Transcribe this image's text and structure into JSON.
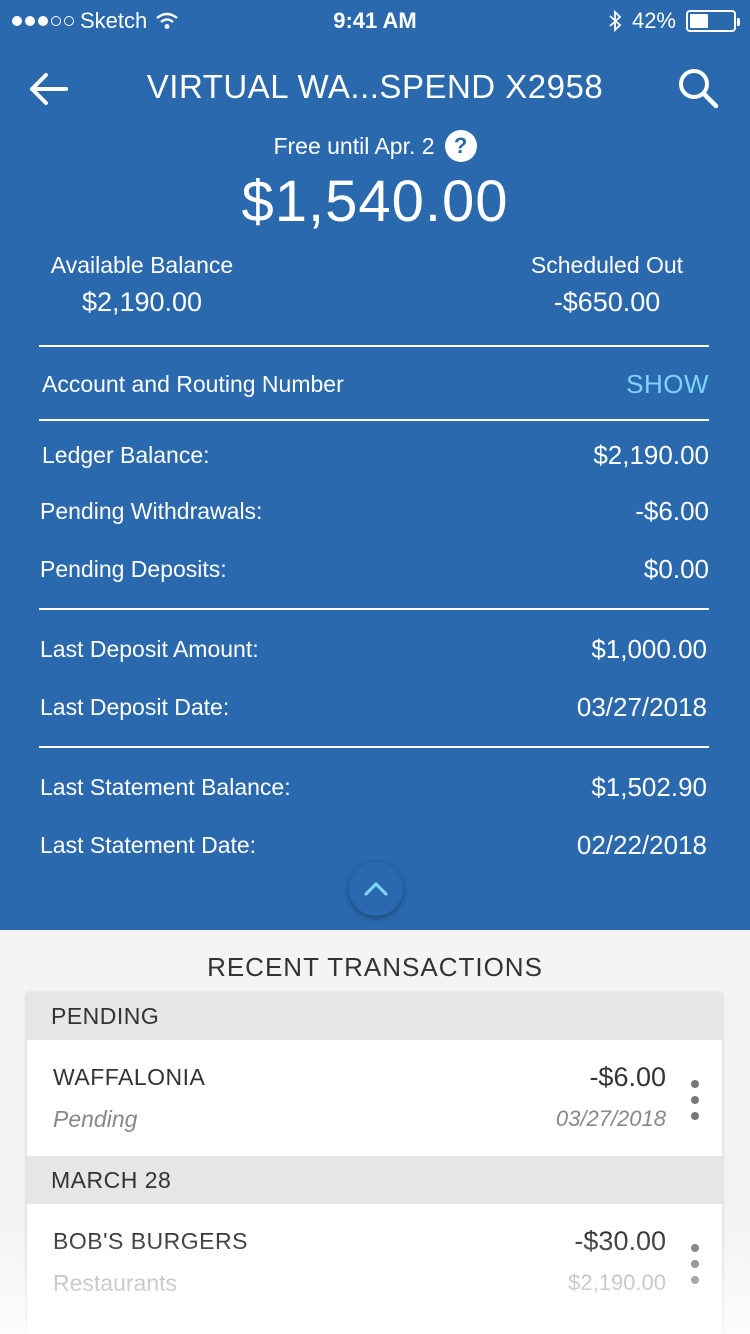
{
  "status_bar": {
    "carrier": "Sketch",
    "time": "9:41 AM",
    "battery": "42%",
    "battery_level": 0.42
  },
  "nav": {
    "title": "VIRTUAL WA...SPEND X2958"
  },
  "summary": {
    "free_until": "Free until Apr. 2",
    "main_balance": "$1,540.00",
    "available_label": "Available Balance",
    "available_value": "$2,190.00",
    "scheduled_label": "Scheduled Out",
    "scheduled_value": "-$650.00"
  },
  "account_routing": {
    "label": "Account and Routing Number",
    "action": "SHOW"
  },
  "details": {
    "ledger_label": "Ledger Balance:",
    "ledger_value": "$2,190.00",
    "pending_withdrawals_label": "Pending Withdrawals:",
    "pending_withdrawals_value": "-$6.00",
    "pending_deposits_label": "Pending Deposits:",
    "pending_deposits_value": "$0.00",
    "last_deposit_amount_label": "Last Deposit Amount:",
    "last_deposit_amount_value": "$1,000.00",
    "last_deposit_date_label": "Last Deposit Date:",
    "last_deposit_date_value": "03/27/2018",
    "last_statement_balance_label": "Last Statement Balance:",
    "last_statement_balance_value": "$1,502.90",
    "last_statement_date_label": "Last Statement Date:",
    "last_statement_date_value": "02/22/2018"
  },
  "transactions": {
    "title": "RECENT TRANSACTIONS",
    "sections": [
      {
        "header": "PENDING",
        "items": [
          {
            "name": "WAFFALONIA",
            "sub": "Pending",
            "amount": "-$6.00",
            "date": "03/27/2018"
          }
        ]
      },
      {
        "header": "MARCH 28",
        "items": [
          {
            "name": "BOB'S BURGERS",
            "sub": "Restaurants",
            "amount": "-$30.00",
            "date": "$2,190.00"
          }
        ]
      }
    ]
  },
  "colors": {
    "header_bg": "#2a69ad",
    "link": "#7ed4ff"
  },
  "icons": {
    "back": "arrow-left-icon",
    "search": "search-icon",
    "help": "question-circle-icon",
    "collapse": "chevron-up-icon",
    "more": "more-vertical-icon"
  }
}
